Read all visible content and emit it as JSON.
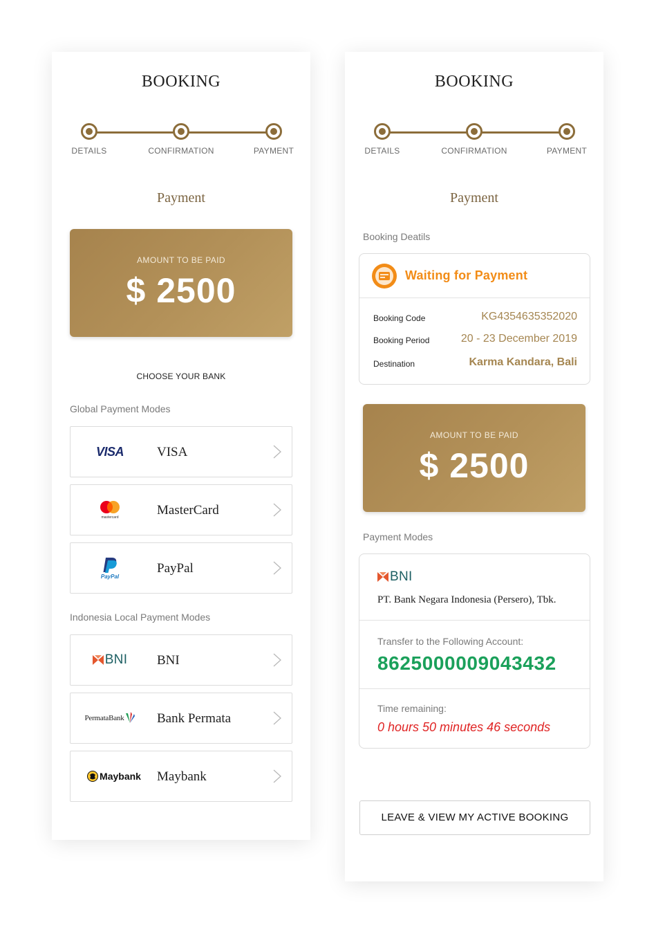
{
  "left": {
    "title": "BOOKING",
    "steps": [
      "DETAILS",
      "CONFIRMATION",
      "PAYMENT"
    ],
    "section_title": "Payment",
    "amount_label": "AMOUNT TO BE PAID",
    "amount_value": "$ 2500",
    "choose_bank": "CHOOSE YOUR BANK",
    "global_label": "Global Payment Modes",
    "global_options": [
      {
        "name": "VISA",
        "logo_text": "VISA",
        "icon": "visa-logo"
      },
      {
        "name": "MasterCard",
        "logo_text": "mastercard",
        "icon": "mastercard-logo"
      },
      {
        "name": "PayPal",
        "logo_text": "PayPal",
        "icon": "paypal-logo"
      }
    ],
    "local_label": "Indonesia Local Payment Modes",
    "local_options": [
      {
        "name": "BNI",
        "logo_text": "BNI",
        "icon": "bni-logo"
      },
      {
        "name": "Bank Permata",
        "logo_text": "PermataBank",
        "icon": "permata-logo"
      },
      {
        "name": "Maybank",
        "logo_text": "Maybank",
        "icon": "maybank-logo"
      }
    ]
  },
  "right": {
    "title": "BOOKING",
    "steps": [
      "DETAILS",
      "CONFIRMATION",
      "PAYMENT"
    ],
    "section_title": "Payment",
    "booking_details_label": "Booking Deatils",
    "status": "Waiting for Payment",
    "details": [
      {
        "key": "Booking Code",
        "value": "KG4354635352020"
      },
      {
        "key": "Booking Period",
        "value": "20 - 23 December 2019"
      },
      {
        "key": "Destination",
        "value": "Karma Kandara, Bali"
      }
    ],
    "amount_label": "AMOUNT TO BE PAID",
    "amount_value": "$ 2500",
    "payment_modes_label": "Payment Modes",
    "bank_logo_text": "BNI",
    "bank_name": "PT. Bank Negara Indonesia (Persero), Tbk.",
    "transfer_label": "Transfer to the Following Account:",
    "account_number": "8625000009043432",
    "time_label": "Time remaining:",
    "time_value": "0 hours 50 minutes 46 seconds",
    "leave_button": "LEAVE & VIEW MY ACTIVE BOOKING"
  },
  "colors": {
    "gold": "#a58651",
    "gold_dark": "#8c6d3a",
    "status_orange": "#f28c17",
    "account_green": "#1aa05a",
    "time_red": "#e02424"
  }
}
